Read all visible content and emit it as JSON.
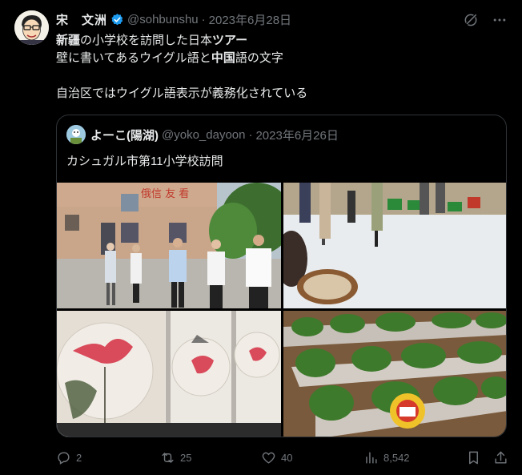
{
  "tweet": {
    "author_name": "宋　文洲",
    "handle": "@sohbunshu",
    "separator": "·",
    "date": "2023年6月28日",
    "lines": [
      {
        "pre": "",
        "b1": "新疆",
        "mid1": "の小学校を訪問した日本",
        "b2": "ツアー",
        "post": ""
      },
      {
        "pre": "壁に書いてあるウイグル語と",
        "b1": "中国",
        "mid1": "語の文字",
        "b2": "",
        "post": ""
      },
      {
        "pre": "",
        "b1": "",
        "mid1": "",
        "b2": "",
        "post": ""
      },
      {
        "pre": "自治区ではウイグル語表示が義務化されている",
        "b1": "",
        "mid1": "",
        "b2": "",
        "post": ""
      }
    ]
  },
  "quote": {
    "author_name": "よーこ(陽湖)",
    "handle": "@yoko_dayoon",
    "separator": "·",
    "date": "2023年6月26日",
    "text": "カシュガル市第11小学校訪問",
    "images": [
      {
        "name": "school-courtyard-photo",
        "banner_text": "俄信 友 看"
      },
      {
        "name": "school-hall-photo"
      },
      {
        "name": "flower-paintings-photo"
      },
      {
        "name": "vegetable-garden-photo"
      }
    ]
  },
  "actions": {
    "replies": "2",
    "retweets": "25",
    "likes": "40",
    "views": "8,542"
  },
  "colors": {
    "background": "#000000",
    "text": "#e7e9ea",
    "muted": "#71767b",
    "verified": "#1d9bf0",
    "border": "#2f3336"
  }
}
